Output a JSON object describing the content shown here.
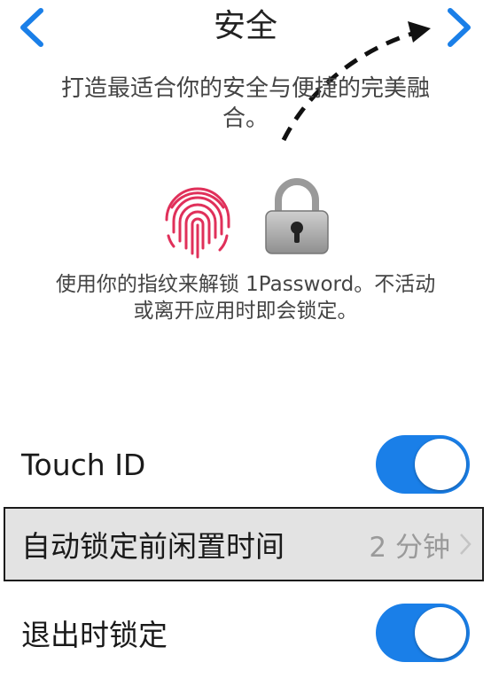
{
  "nav": {
    "title": "安全"
  },
  "intro": {
    "subtitle_line1": "打造最适合你的安全与便捷的完美融",
    "subtitle_line2": "合。"
  },
  "touchid_info": {
    "description_line1": "使用你的指纹来解锁 1Password。不活动",
    "description_line2": "或离开应用时即会锁定。"
  },
  "settings": {
    "touch_id": {
      "label": "Touch ID",
      "enabled": true
    },
    "auto_lock": {
      "label": "自动锁定前闲置时间",
      "value": "2 分钟"
    },
    "lock_on_exit": {
      "label": "退出时锁定",
      "enabled": true
    }
  },
  "colors": {
    "accent": "#1a7fe8",
    "fingerprint": "#e0305a",
    "row_highlight": "#e3e3e3",
    "secondary_text": "#9a9a9a"
  },
  "icons": {
    "back": "chevron-left-icon",
    "forward": "chevron-right-icon",
    "fingerprint": "fingerprint-icon",
    "lock": "padlock-icon",
    "row_chevron": "chevron-right-icon"
  }
}
